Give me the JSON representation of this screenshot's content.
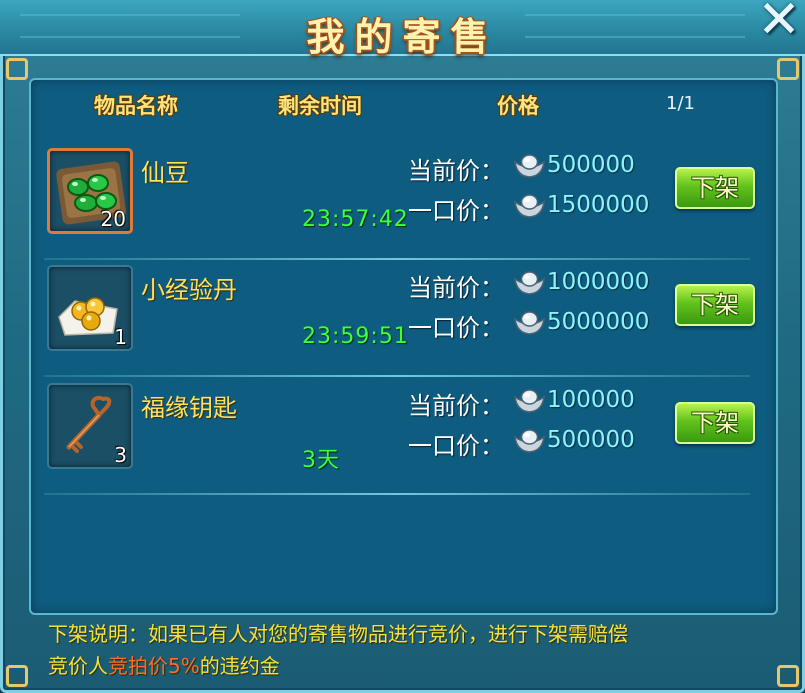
{
  "window": {
    "title": "我的寄售",
    "close_label": "✕"
  },
  "table": {
    "headers": {
      "name": "物品名称",
      "time": "剩余时间",
      "price": "价格"
    },
    "page": "1/1"
  },
  "labels": {
    "current_price": "当前价：",
    "buyout_price": "一口价：",
    "delist_button": "下架"
  },
  "items": [
    {
      "name": "仙豆",
      "count": "20",
      "time_left": "23:57:42",
      "current_price": "500000",
      "buyout_price": "1500000",
      "icon": "green-beans-icon",
      "selected": true
    },
    {
      "name": "小经验丹",
      "count": "1",
      "time_left": "23:59:51",
      "current_price": "1000000",
      "buyout_price": "5000000",
      "icon": "gold-pills-icon",
      "selected": false
    },
    {
      "name": "福缘钥匙",
      "count": "3",
      "time_left": "3天",
      "current_price": "100000",
      "buyout_price": "500000",
      "icon": "bronze-key-icon",
      "selected": false
    }
  ],
  "note": {
    "line1": "下架说明：如果已有人对您的寄售物品进行竞价，进行下架需赔偿",
    "line2_a": "竞价人",
    "line2_highlight": "竞拍价5%",
    "line2_b": "的违约金"
  },
  "colors": {
    "frame": "#1f6a82",
    "panel": "#0e5c80",
    "header_gold": "#ffe37a",
    "item_name": "#ffe160",
    "time_green": "#3dff3d",
    "price_cyan": "#8ff3ff",
    "button_green": "#62c21c",
    "note_yellow": "#f6e23a",
    "note_highlight": "#ff6a2a"
  }
}
